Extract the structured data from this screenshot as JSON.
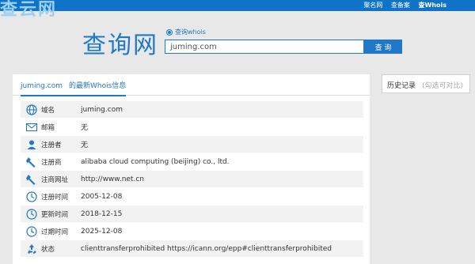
{
  "site": {
    "watermark": "查云网",
    "top_links": [
      "聚名网",
      "查备案",
      "查Whois"
    ]
  },
  "logo": "查询网",
  "search": {
    "radio_label": "查询whois",
    "value": "juming.com",
    "button_label": "查 询"
  },
  "tab": {
    "domain": "juming.com",
    "title": "的最新Whois信息"
  },
  "side": {
    "title": "历史记录",
    "hint": "(勾选可对比)"
  },
  "colors": {
    "accent": "#1f78c8",
    "topbar": "#0f74c8"
  },
  "rows": [
    {
      "icon": "globe-icon",
      "label": "域名",
      "value": "juming.com"
    },
    {
      "icon": "mail-icon",
      "label": "邮箱",
      "value": "无"
    },
    {
      "icon": "user-icon",
      "label": "注册者",
      "value": "无"
    },
    {
      "icon": "wrench-icon",
      "label": "注册商",
      "value": "alibaba cloud computing (beijing) co., ltd."
    },
    {
      "icon": "wrench-icon",
      "label": "注商网址",
      "value": "http://www.net.cn"
    },
    {
      "icon": "clock-icon",
      "label": "注册时间",
      "value": "2005-12-08"
    },
    {
      "icon": "clock-icon",
      "label": "更新时间",
      "value": "2018-12-15"
    },
    {
      "icon": "clock-icon",
      "label": "过期时间",
      "value": "2025-12-08"
    },
    {
      "icon": "recycle-icon",
      "label": "状态",
      "value": "clienttransferprohibited https://icann.org/epp#clienttransferprohibited"
    }
  ]
}
